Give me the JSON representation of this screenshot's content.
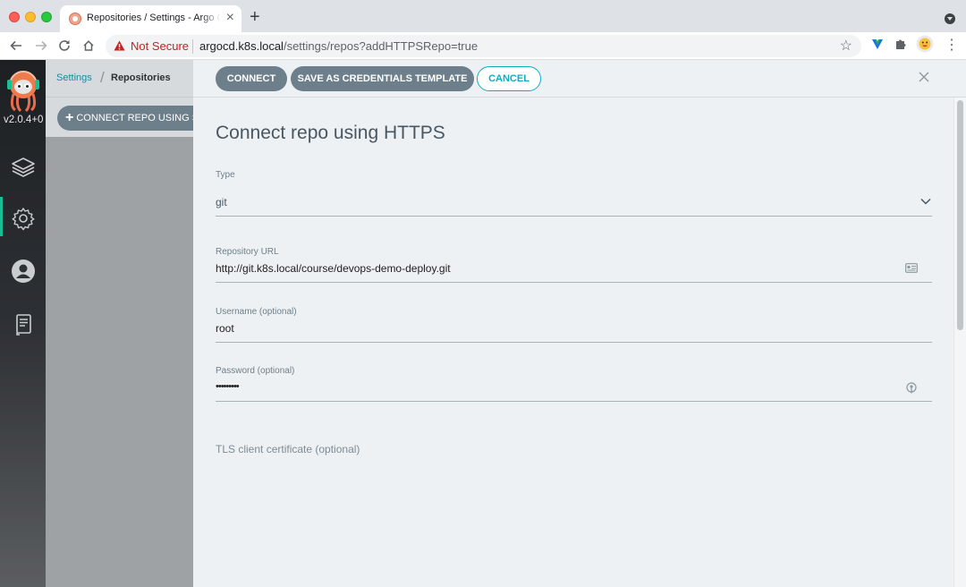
{
  "browser": {
    "tab_title": "Repositories / Settings - Argo CD",
    "tab_close": "×",
    "new_tab": "+",
    "security_label": "Not Secure",
    "url_host": "argocd.k8s.local",
    "url_path": "/settings/repos?addHTTPSRepo=true",
    "nav_icons": [
      "back-arrow-icon",
      "forward-arrow-icon",
      "reload-icon",
      "home-icon"
    ],
    "extension_icons": [
      "vue-devtools-icon",
      "extensions-puzzle-icon",
      "profile-avatar-icon"
    ]
  },
  "sidebar": {
    "version": "v2.0.4+0",
    "items": [
      {
        "name": "applications",
        "icon": "layers-icon"
      },
      {
        "name": "settings",
        "icon": "gear-icon",
        "active": true
      },
      {
        "name": "user-info",
        "icon": "user-icon"
      },
      {
        "name": "documentation",
        "icon": "book-icon"
      }
    ]
  },
  "breadcrumb": {
    "settings": "Settings",
    "separator": "/",
    "current": "Repositories"
  },
  "actions": {
    "connect_ssh": "CONNECT REPO USING SSH",
    "plus": "+"
  },
  "panel": {
    "buttons": {
      "connect": "CONNECT",
      "save_template": "SAVE AS CREDENTIALS TEMPLATE",
      "cancel": "CANCEL"
    },
    "title": "Connect repo using HTTPS",
    "fields": {
      "type_label": "Type",
      "type_value": "git",
      "url_label": "Repository URL",
      "url_value": "http://git.k8s.local/course/devops-demo-deploy.git",
      "username_label": "Username (optional)",
      "username_value": "root",
      "password_label": "Password (optional)",
      "password_value": "•••••••••",
      "tls_label": "TLS client certificate (optional)"
    },
    "colors": {
      "primary_button": "#6d7f8b",
      "accent": "#0dadc0",
      "active_indicator": "#18be94"
    }
  }
}
